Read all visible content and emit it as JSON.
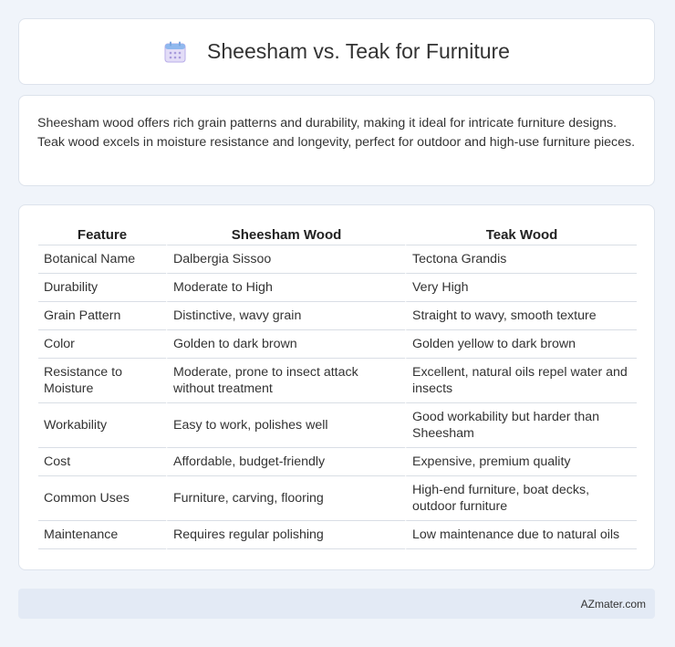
{
  "header": {
    "title": "Sheesham vs. Teak for Furniture",
    "icon": "calendar-icon"
  },
  "summary": {
    "text": "Sheesham wood offers rich grain patterns and durability, making it ideal for intricate furniture designs. Teak wood excels in moisture resistance and longevity, perfect for outdoor and high-use furniture pieces."
  },
  "table": {
    "headers": [
      "Feature",
      "Sheesham Wood",
      "Teak Wood"
    ],
    "rows": [
      [
        "Botanical Name",
        "Dalbergia Sissoo",
        "Tectona Grandis"
      ],
      [
        "Durability",
        "Moderate to High",
        "Very High"
      ],
      [
        "Grain Pattern",
        "Distinctive, wavy grain",
        "Straight to wavy, smooth texture"
      ],
      [
        "Color",
        "Golden to dark brown",
        "Golden yellow to dark brown"
      ],
      [
        "Resistance to Moisture",
        "Moderate, prone to insect attack without treatment",
        "Excellent, natural oils repel water and insects"
      ],
      [
        "Workability",
        "Easy to work, polishes well",
        "Good workability but harder than Sheesham"
      ],
      [
        "Cost",
        "Affordable, budget-friendly",
        "Expensive, premium quality"
      ],
      [
        "Common Uses",
        "Furniture, carving, flooring",
        "High-end furniture, boat decks, outdoor furniture"
      ],
      [
        "Maintenance",
        "Requires regular polishing",
        "Low maintenance due to natural oils"
      ]
    ]
  },
  "footer": {
    "text": "AZmater.com"
  }
}
